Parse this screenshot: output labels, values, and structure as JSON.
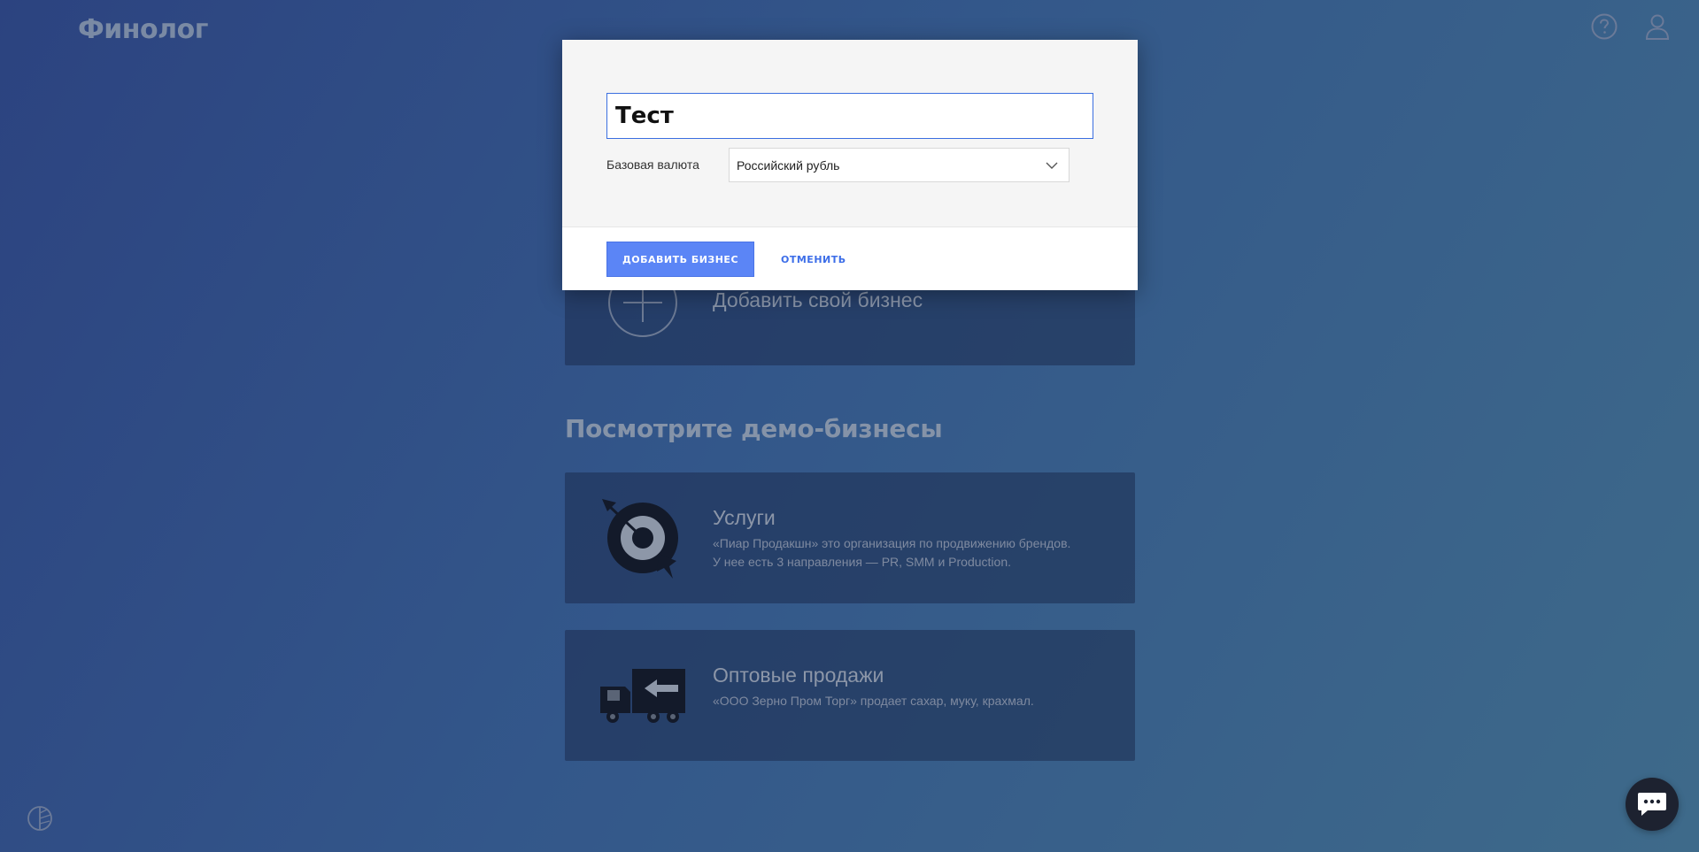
{
  "header": {
    "logo": "Финолог",
    "help_icon": "help-icon",
    "user_icon": "user-icon"
  },
  "page": {
    "add_business_label": "Добавить свой бизнес",
    "demo_section_title": "Посмотрите демо-бизнесы",
    "demos": [
      {
        "title": "Услуги",
        "description_lines": [
          "«Пиар Продакшн» это организация по продвижению брендов.",
          "У нее есть 3 направления — PR, SMM и Production."
        ],
        "icon": "target-icon"
      },
      {
        "title": "Оптовые продажи",
        "description_lines": [
          "«ООО Зерно Пром Торг» продает сахар, муку, крахмал."
        ],
        "icon": "truck-icon"
      }
    ]
  },
  "modal": {
    "name_value": "Тест",
    "currency_label": "Базовая валюта",
    "currency_value": "Российский рубль",
    "submit_label": "ДОБАВИТЬ БИЗНЕС",
    "cancel_label": "ОТМЕНИТЬ"
  },
  "colors": {
    "accent": "#5b85f6",
    "link": "#3d6ee8",
    "input_border": "#3b6fe0"
  }
}
